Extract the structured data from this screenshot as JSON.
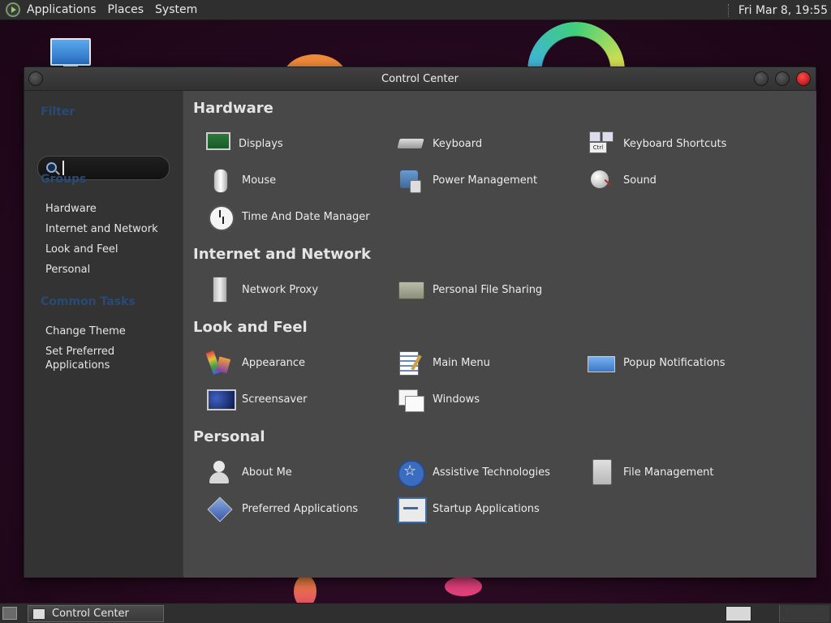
{
  "top_panel": {
    "menus": [
      "Applications",
      "Places",
      "System"
    ],
    "clock": "Fri Mar  8, 19:55"
  },
  "window": {
    "title": "Control Center"
  },
  "sidebar": {
    "filter_heading": "Filter",
    "search_placeholder": "",
    "groups_heading": "Groups",
    "groups": [
      "Hardware",
      "Internet and Network",
      "Look and Feel",
      "Personal"
    ],
    "common_tasks_heading": "Common Tasks",
    "tasks": [
      "Change Theme",
      "Set Preferred Applications"
    ]
  },
  "sections": [
    {
      "title": "Hardware",
      "items": [
        {
          "label": "Displays",
          "icon": "displays-icon"
        },
        {
          "label": "Keyboard",
          "icon": "keyboard-icon"
        },
        {
          "label": "Keyboard Shortcuts",
          "icon": "keyboard-shortcuts-icon"
        },
        {
          "label": "Mouse",
          "icon": "mouse-icon"
        },
        {
          "label": "Power Management",
          "icon": "power-management-icon"
        },
        {
          "label": "Sound",
          "icon": "sound-icon"
        },
        {
          "label": "Time And Date Manager",
          "icon": "clock-icon"
        }
      ]
    },
    {
      "title": "Internet and Network",
      "items": [
        {
          "label": "Network Proxy",
          "icon": "network-proxy-icon"
        },
        {
          "label": "Personal File Sharing",
          "icon": "file-sharing-icon"
        }
      ]
    },
    {
      "title": "Look and Feel",
      "items": [
        {
          "label": "Appearance",
          "icon": "appearance-icon"
        },
        {
          "label": "Main Menu",
          "icon": "main-menu-icon"
        },
        {
          "label": "Popup Notifications",
          "icon": "popup-notifications-icon"
        },
        {
          "label": "Screensaver",
          "icon": "screensaver-icon"
        },
        {
          "label": "Windows",
          "icon": "windows-icon"
        }
      ]
    },
    {
      "title": "Personal",
      "items": [
        {
          "label": "About Me",
          "icon": "about-me-icon"
        },
        {
          "label": "Assistive Technologies",
          "icon": "assistive-technologies-icon"
        },
        {
          "label": "File Management",
          "icon": "file-management-icon"
        },
        {
          "label": "Preferred Applications",
          "icon": "preferred-applications-icon"
        },
        {
          "label": "Startup Applications",
          "icon": "startup-applications-icon"
        }
      ]
    }
  ],
  "taskbar": {
    "task_label": "Control Center"
  }
}
